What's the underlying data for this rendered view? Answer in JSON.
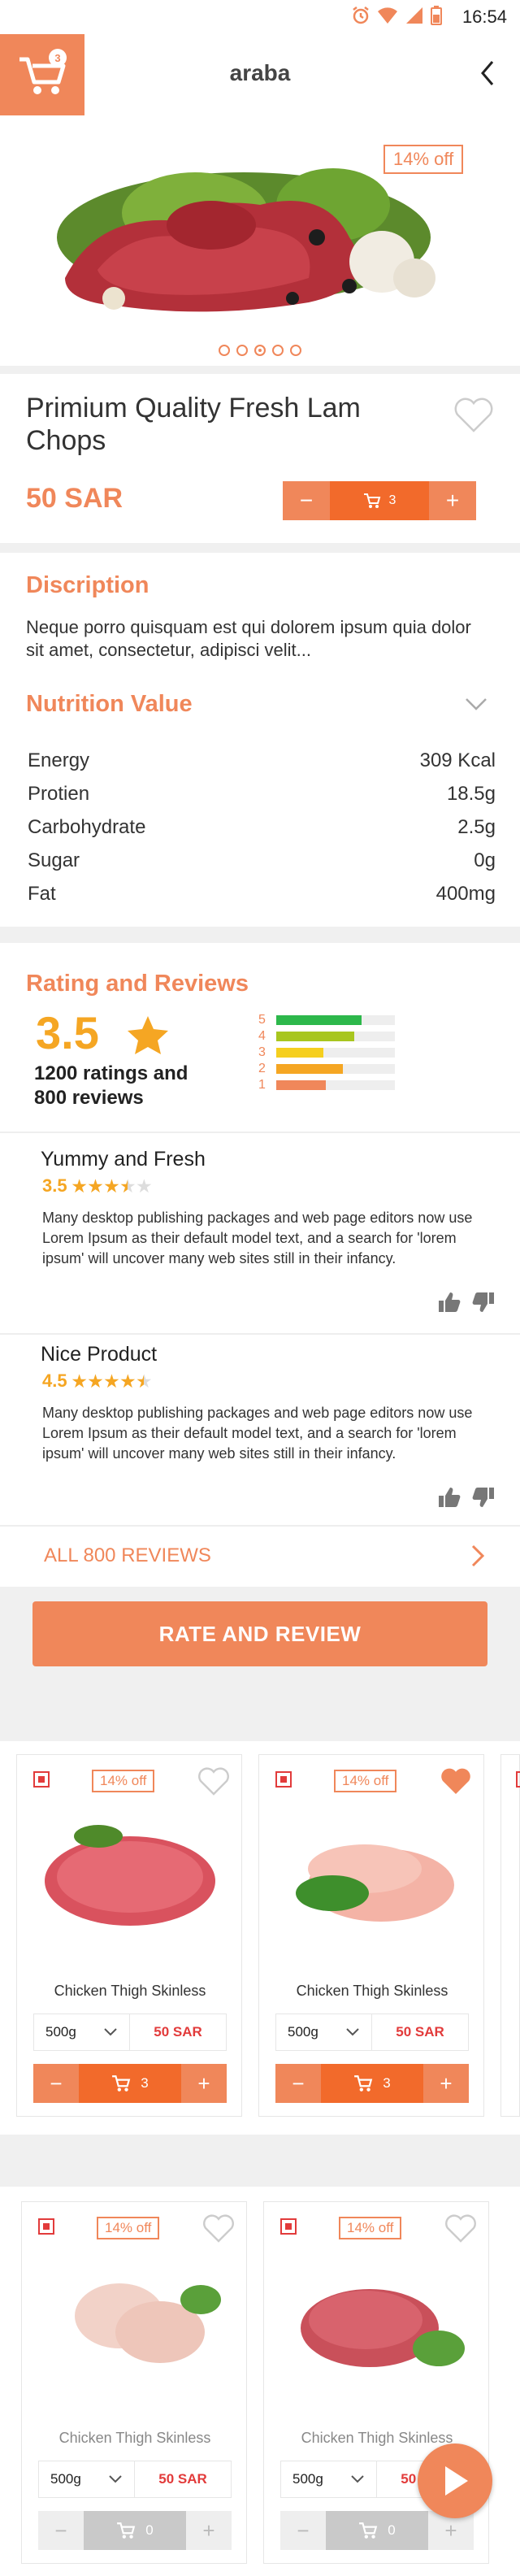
{
  "status_bar": {
    "time": "16:54"
  },
  "header": {
    "brand": "araba",
    "cart_count": "3"
  },
  "product": {
    "discount": "14% off",
    "title": "Primium Quality Fresh Lam Chops",
    "price": "50 SAR",
    "quantity": "3",
    "image_dots": 5,
    "active_dot": 3
  },
  "description": {
    "heading": "Discription",
    "text": "Neque porro quisquam est qui dolorem ipsum quia dolor sit amet, consectetur, adipisci velit..."
  },
  "nutrition": {
    "heading": "Nutrition Value",
    "rows": [
      {
        "label": "Energy",
        "value": "309 Kcal"
      },
      {
        "label": "Protien",
        "value": "18.5g"
      },
      {
        "label": "Carbohydrate",
        "value": "2.5g"
      },
      {
        "label": "Sugar",
        "value": "0g"
      },
      {
        "label": "Fat",
        "value": "400mg"
      }
    ]
  },
  "reviews": {
    "heading": "Rating and Reviews",
    "average": "3.5",
    "summary": "1200 ratings and 800 reviews",
    "distribution": [
      {
        "star": "5",
        "fraction": 0.72,
        "color": "#2db84b"
      },
      {
        "star": "4",
        "fraction": 0.66,
        "color": "#a8c61f"
      },
      {
        "star": "3",
        "fraction": 0.4,
        "color": "#f5cf1e"
      },
      {
        "star": "2",
        "fraction": 0.56,
        "color": "#f5a623"
      },
      {
        "star": "1",
        "fraction": 0.42,
        "color": "#f0875a"
      }
    ],
    "items": [
      {
        "title": "Yummy and Fresh",
        "score": "3.5",
        "body": "Many desktop publishing packages and web page editors now use Lorem Ipsum as their default model text, and a search for 'lorem ipsum' will uncover many web sites still in their infancy."
      },
      {
        "title": "Nice Product",
        "score": "4.5",
        "body": "Many desktop publishing packages and web page editors now use Lorem Ipsum as their default model text, and a search for 'lorem ipsum' will uncover many web sites still in their infancy."
      }
    ],
    "all_link": "ALL 800 REVIEWS",
    "rate_button": "RATE AND REVIEW"
  },
  "related": [
    {
      "name": "Chicken Thigh Skinless",
      "discount": "14% off",
      "weight": "500g",
      "price": "50 SAR",
      "qty": "3",
      "favorite": false
    },
    {
      "name": "Chicken Thigh Skinless",
      "discount": "14% off",
      "weight": "500g",
      "price": "50 SAR",
      "qty": "3",
      "favorite": true
    },
    {
      "name": "Chicken Thigh Skinless",
      "discount": "14% off",
      "weight": "500g",
      "price": "50 SAR",
      "qty": "0",
      "favorite": false
    },
    {
      "name": "Chicken Thigh Skinless",
      "discount": "14% off",
      "weight": "500g",
      "price": "50 SAR",
      "qty": "0",
      "favorite": false
    }
  ],
  "colors": {
    "accent": "#f0875a",
    "accent_dark": "#f26a2b",
    "star": "#f5a623",
    "price_red": "#e23b3b"
  }
}
